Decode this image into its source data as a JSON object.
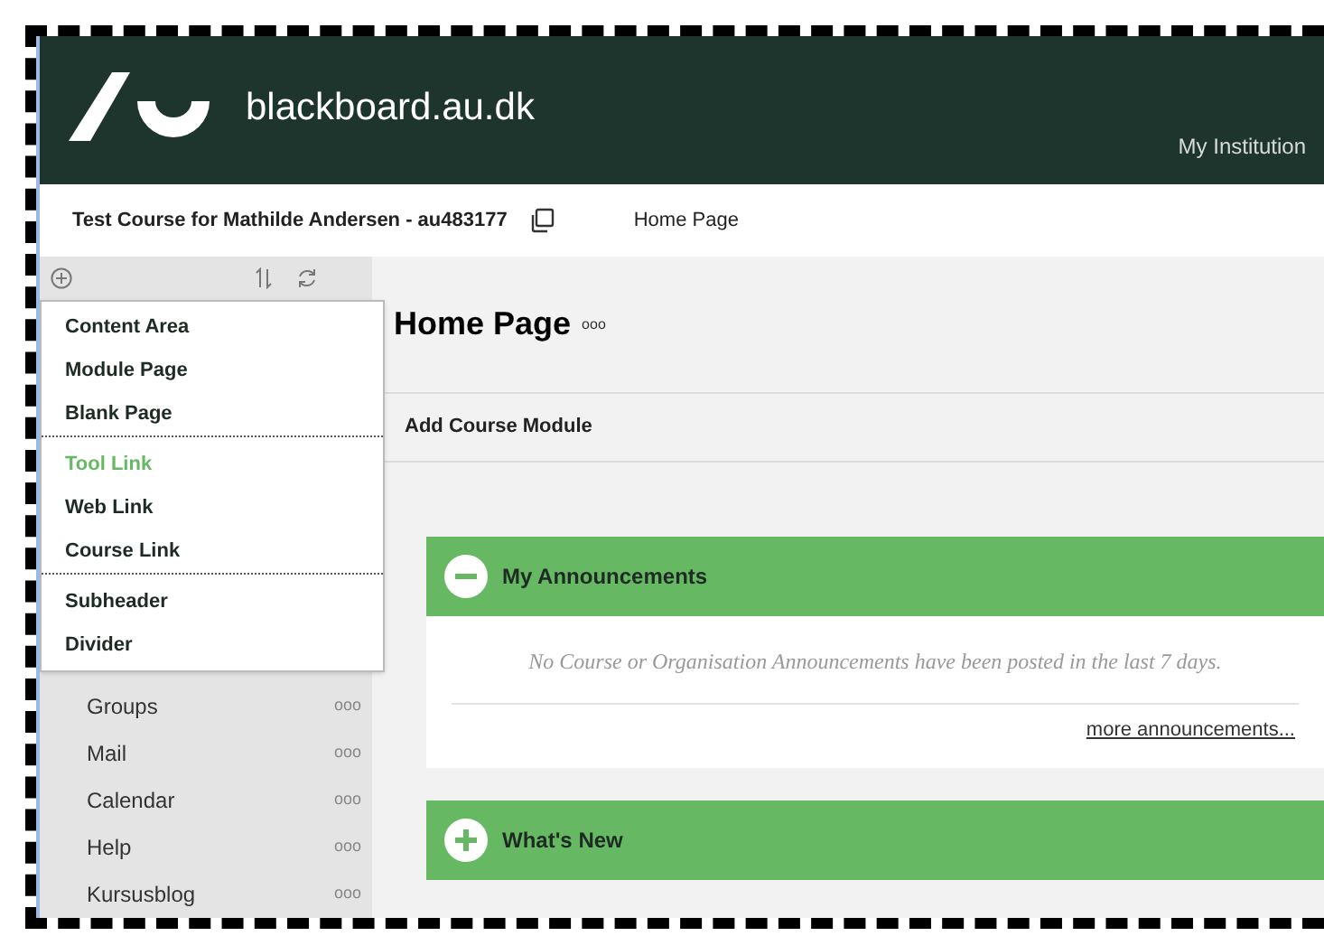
{
  "header": {
    "site": "blackboard.au.dk",
    "nav": "My Institution"
  },
  "breadcrumb": {
    "course": "Test Course for Mathilde Andersen - au483177",
    "page": "Home Page"
  },
  "add_menu": {
    "groups": [
      [
        {
          "label": "Content Area",
          "selected": false
        },
        {
          "label": "Module Page",
          "selected": false
        },
        {
          "label": "Blank Page",
          "selected": false
        }
      ],
      [
        {
          "label": "Tool Link",
          "selected": true
        },
        {
          "label": "Web Link",
          "selected": false
        },
        {
          "label": "Course Link",
          "selected": false
        }
      ],
      [
        {
          "label": "Subheader",
          "selected": false
        },
        {
          "label": "Divider",
          "selected": false
        }
      ]
    ]
  },
  "sidebar": {
    "items": [
      {
        "label": "Groups",
        "more": "ooo"
      },
      {
        "label": "Mail",
        "more": "ooo"
      },
      {
        "label": "Calendar",
        "more": "ooo"
      },
      {
        "label": "Help",
        "more": "ooo"
      },
      {
        "label": "Kursusblog",
        "more": "ooo"
      }
    ]
  },
  "page": {
    "title": "Home Page",
    "title_more": "ooo",
    "toolbar_button": "Add Course Module"
  },
  "modules": [
    {
      "title": "My Announcements",
      "expanded": true,
      "message": "No Course or Organisation Announcements have been posted in the last 7 days.",
      "link": "more announcements..."
    },
    {
      "title": "What's New",
      "expanded": false
    }
  ]
}
